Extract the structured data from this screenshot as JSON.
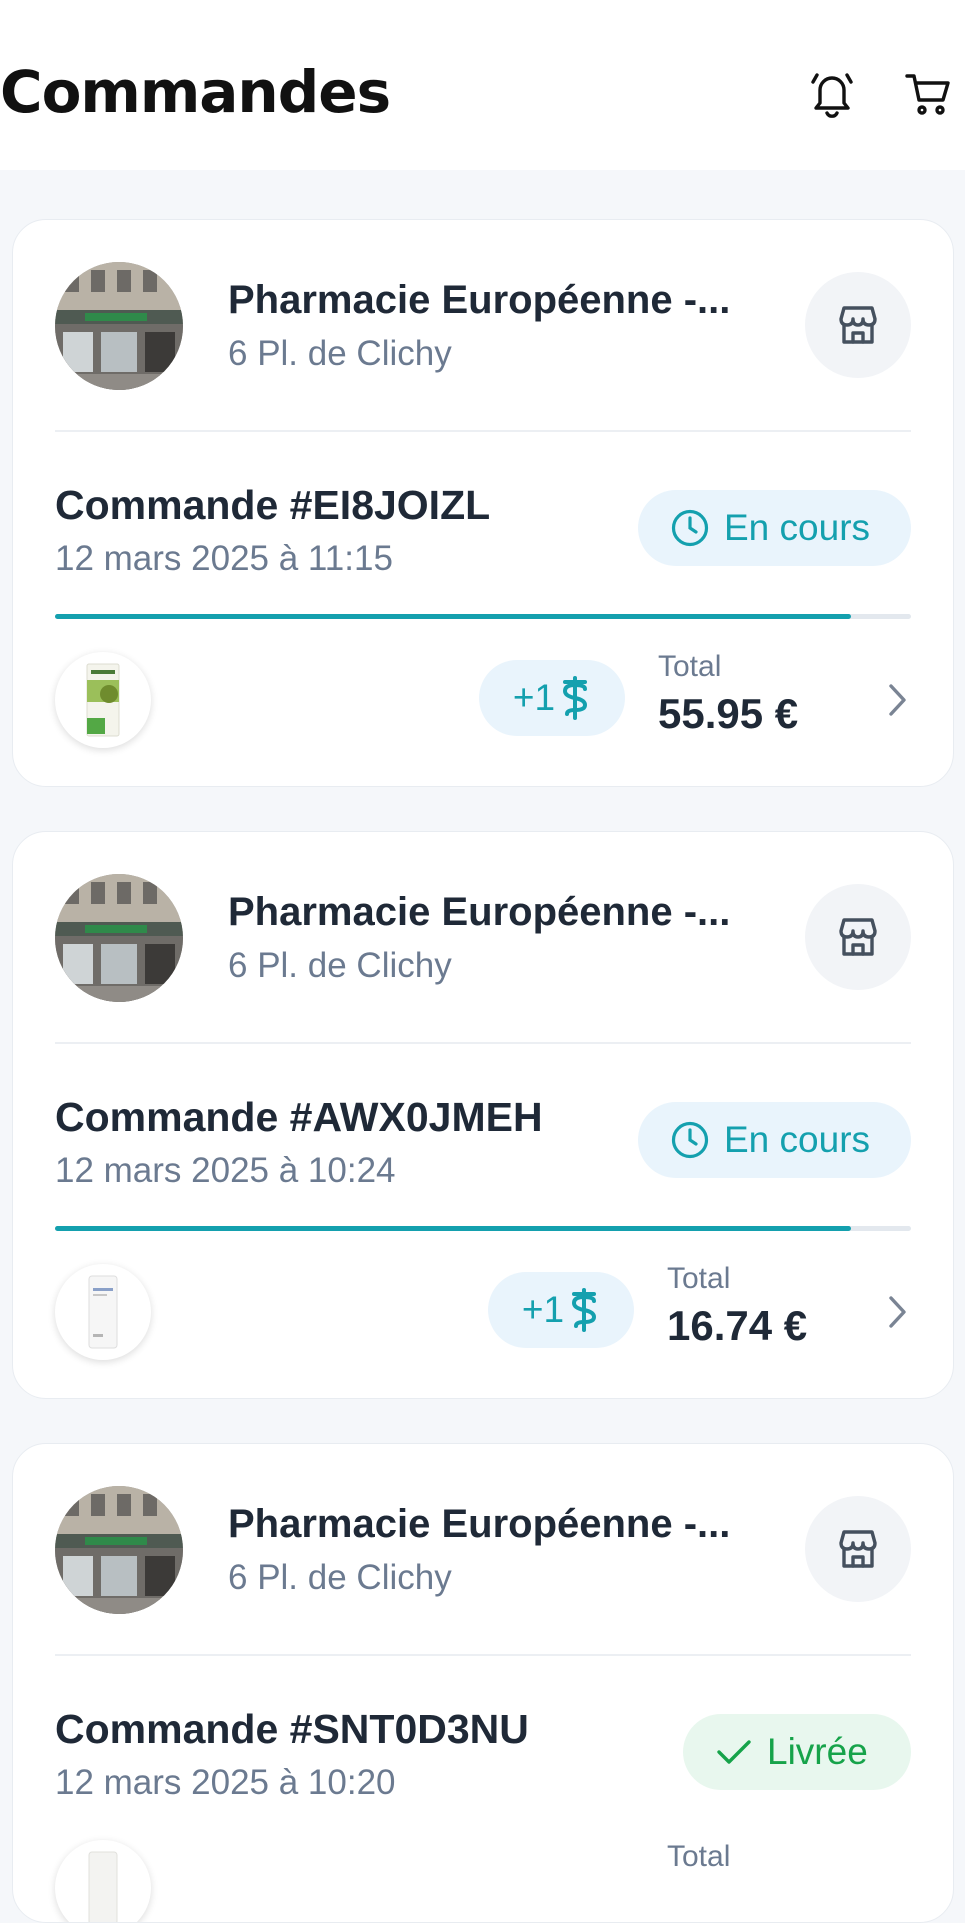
{
  "header": {
    "title": "Commandes",
    "icons": [
      "bell-icon",
      "cart-icon"
    ]
  },
  "colors": {
    "accent": "#14a0ae",
    "in_progress_bg": "#e9f4fc",
    "delivered": "#16a34a",
    "delivered_bg": "#e8f7ee",
    "muted_text": "#6b7a90"
  },
  "orders": [
    {
      "pharmacy_name": "Pharmacie Européenne -...",
      "pharmacy_address": "6 Pl. de Clichy",
      "order_number": "Commande #EI8JOIZL",
      "date": "12 mars 2025 à 11:15",
      "status": "En cours",
      "status_icon": "clock-icon",
      "progress": 0.93,
      "extra_items": "+1",
      "total_label": "Total",
      "total": "55.95 €"
    },
    {
      "pharmacy_name": "Pharmacie Européenne -...",
      "pharmacy_address": "6 Pl. de Clichy",
      "order_number": "Commande #AWX0JMEH",
      "date": "12 mars 2025 à 10:24",
      "status": "En cours",
      "status_icon": "clock-icon",
      "progress": 0.93,
      "extra_items": "+1",
      "total_label": "Total",
      "total": "16.74 €"
    },
    {
      "pharmacy_name": "Pharmacie Européenne -...",
      "pharmacy_address": "6 Pl. de Clichy",
      "order_number": "Commande #SNT0D3NU",
      "date": "12 mars 2025 à 10:20",
      "status": "Livrée",
      "status_icon": "check-icon",
      "total_label": "Total"
    }
  ]
}
